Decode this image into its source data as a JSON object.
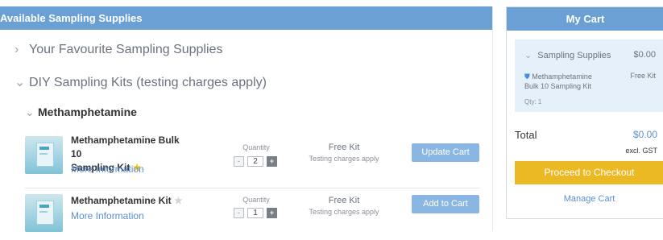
{
  "left_panel": {
    "title": "Available Sampling Supplies",
    "sections": [
      {
        "label": "Your Favourite Sampling Supplies",
        "expanded": false
      },
      {
        "label": "DIY Sampling Kits (testing charges apply)",
        "expanded": true
      }
    ],
    "subsection": {
      "label": "Methamphetamine"
    },
    "products": [
      {
        "name_line1": "Methamphetamine Bulk 10",
        "name_line2": "Sampling Kit",
        "favourite": true,
        "more_label": "More Information",
        "qty_label": "Quantity",
        "qty_value": "2",
        "price_main": "Free Kit",
        "price_sub": "Testing charges apply",
        "action_label": "Update Cart"
      },
      {
        "name_line1": "Methamphetamine Kit",
        "favourite": false,
        "more_label": "More Information",
        "qty_label": "Quantity",
        "qty_value": "1",
        "price_main": "Free Kit",
        "price_sub": "Testing charges apply",
        "action_label": "Add to Cart"
      }
    ]
  },
  "cart": {
    "title": "My Cart",
    "group": {
      "label": "Sampling Supplies",
      "total": "$0.00"
    },
    "item": {
      "name": "Methamphetamine Bulk 10 Sampling Kit",
      "price": "Free Kit",
      "qty": "Qty: 1"
    },
    "total_label": "Total",
    "total_value": "$0.00",
    "total_note": "excl. GST",
    "checkout_label": "Proceed to Checkout",
    "manage_label": "Manage Cart"
  },
  "colors": {
    "header": "#6aa0d4",
    "link": "#5b8fd0",
    "button": "#8ab6e3",
    "checkout": "#ebb924",
    "cart_group_bg": "#e6f0fa"
  },
  "icons": {
    "expand_collapsed": "chevron-right-icon",
    "expand_open": "chevron-down-icon",
    "favourite": "star-icon",
    "cart_item": "shield-icon"
  }
}
